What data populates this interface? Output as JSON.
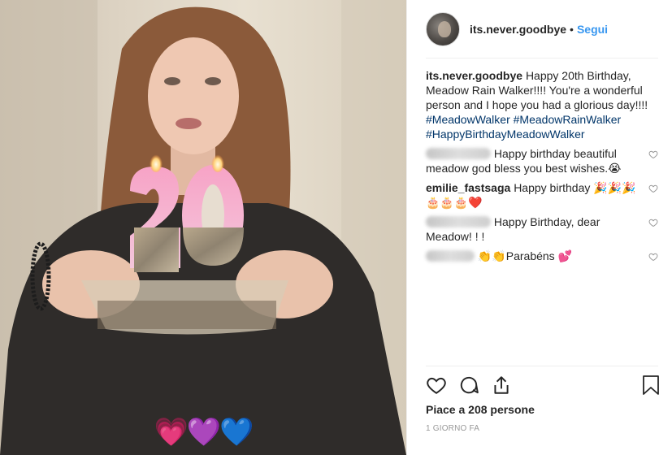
{
  "post": {
    "photo_overlay_emojis": "💗💜💙"
  },
  "header": {
    "username": "its.never.goodbye",
    "separator": "•",
    "follow_label": "Segui"
  },
  "caption": {
    "username": "its.never.goodbye",
    "text": "Happy 20th Birthday, Meadow Rain Walker!!!! You're a wonderful person and I hope you had a glorious day!!!!",
    "hashtags": "#MeadowWalker #MeadowRainWalker #HappyBirthdayMeadowWalker"
  },
  "comments": [
    {
      "username_blurred": true,
      "text": "Happy birthday beautiful meadow god bless you best wishes.😭"
    },
    {
      "username": "emilie_fastsaga",
      "text": "Happy birthday 🎉🎉🎉🎂🎂🎂❤️"
    },
    {
      "username_blurred": true,
      "text": "Happy Birthday, dear Meadow! ! !"
    },
    {
      "username_blurred": true,
      "text": "👏👏Parabéns 💕"
    }
  ],
  "actions": {
    "icons": [
      "heart-icon",
      "comment-icon",
      "share-icon",
      "bookmark-icon"
    ]
  },
  "likes": {
    "text": "Piace a 208 persone"
  },
  "timestamp": {
    "text": "1 GIORNO FA"
  },
  "colors": {
    "link_blue": "#3897f0",
    "hashtag_blue": "#003569",
    "text": "#262626",
    "muted": "#999999",
    "divider": "#efefef"
  }
}
